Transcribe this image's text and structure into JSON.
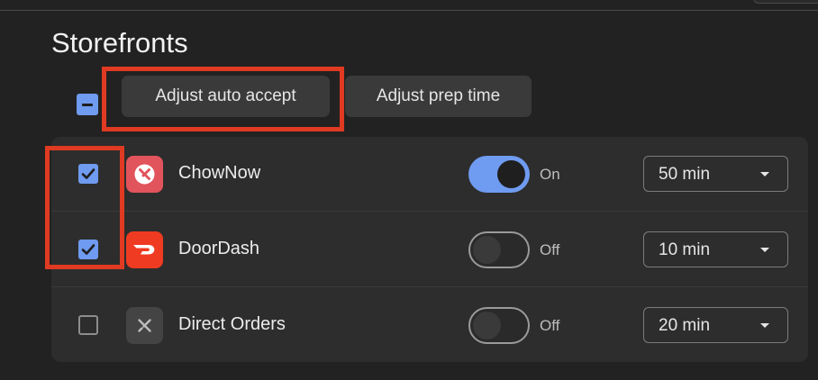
{
  "header": {
    "title": "Storefronts"
  },
  "toolbar": {
    "adjust_auto_accept": "Adjust auto accept",
    "adjust_prep_time": "Adjust prep time"
  },
  "storefronts": [
    {
      "name": "ChowNow",
      "selected": true,
      "logo": "chownow-logo",
      "toggle": "On",
      "prep_time": "50 min"
    },
    {
      "name": "DoorDash",
      "selected": true,
      "logo": "doordash-logo",
      "toggle": "Off",
      "prep_time": "10 min"
    },
    {
      "name": "Direct Orders",
      "selected": false,
      "logo": "utensils-logo",
      "toggle": "Off",
      "prep_time": "20 min"
    }
  ],
  "colors": {
    "accent": "#6f9bf0",
    "annotation": "#e03a22",
    "chownow": "#e2545c",
    "doordash": "#ef3b22"
  }
}
